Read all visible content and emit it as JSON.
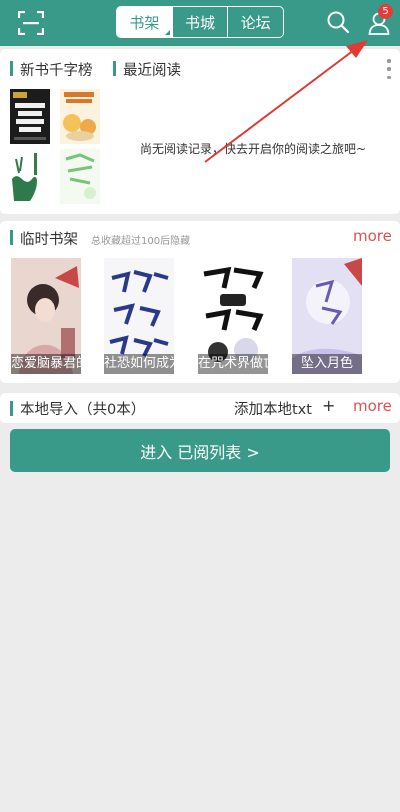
{
  "header": {
    "tabs": [
      {
        "label": "书架",
        "active": true
      },
      {
        "label": "书城",
        "active": false
      },
      {
        "label": "论坛",
        "active": false
      }
    ],
    "notification_count": "5",
    "icons": [
      "scan-icon",
      "search-icon",
      "user-icon"
    ]
  },
  "recent": {
    "tab_rank": "新书千字榜",
    "tab_recent": "最近阅读",
    "empty_message": "尚无阅读记录，快去开启你的阅读之旅吧~"
  },
  "temp_shelf": {
    "title": "临时书架",
    "note": "总收藏超过100后隐藏",
    "more_label": "more",
    "books": [
      {
        "title": "恋爱脑暴君的"
      },
      {
        "title": "社恐如何成为"
      },
      {
        "title": "在咒术界做亡"
      },
      {
        "title": "坠入月色"
      }
    ]
  },
  "local_import": {
    "title": "本地导入（共0本）",
    "add_label": "添加本地txt",
    "plus": "+",
    "more_label": "more"
  },
  "enter_button": {
    "label": "进入 已阅列表 >"
  },
  "colors": {
    "accent": "#3a9a8a",
    "more": "#e05050",
    "badge": "#e23c3c",
    "arrow": "#e03a32"
  }
}
